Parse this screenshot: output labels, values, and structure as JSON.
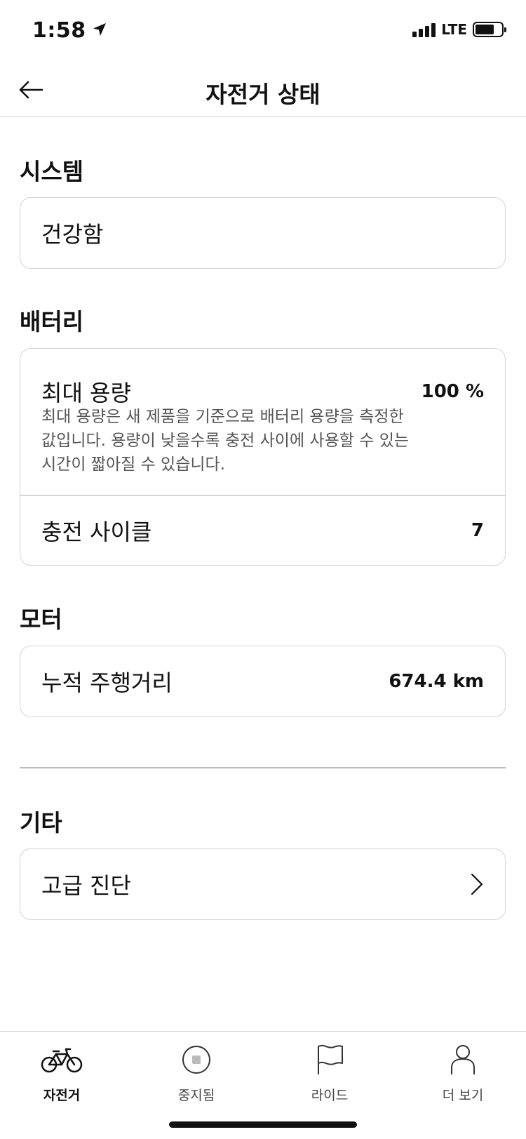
{
  "status_bar": {
    "time": "1:58",
    "network": "LTE"
  },
  "nav": {
    "title": "자전거 상태"
  },
  "system": {
    "title": "시스템",
    "status": "건강함"
  },
  "battery": {
    "title": "배터리",
    "max_capacity_label": "최대 용량",
    "max_capacity_value": "100 %",
    "max_capacity_desc_1": "최대 용량은 새 제품을 기준으로 배터리 용량을 측정한",
    "max_capacity_desc_2": "값입니다. 용량이 낮을수록 충전 사이에 사용할 수 있는",
    "max_capacity_desc_3": "시간이 짧아질 수 있습니다.",
    "charge_cycles_label": "충전 사이클",
    "charge_cycles_value": "7"
  },
  "motor": {
    "title": "모터",
    "odometer_label": "누적 주행거리",
    "odometer_value": "674.4 km"
  },
  "other": {
    "title": "기타",
    "advanced_diagnostics_label": "고급 진단"
  },
  "tab_bar": {
    "tabs": [
      {
        "label": "자전거",
        "icon": "bike-icon",
        "active": true
      },
      {
        "label": "중지됨",
        "icon": "stop-icon",
        "active": false
      },
      {
        "label": "라이드",
        "icon": "flag-icon",
        "active": false
      },
      {
        "label": "더 보기",
        "icon": "person-icon",
        "active": false
      }
    ]
  }
}
